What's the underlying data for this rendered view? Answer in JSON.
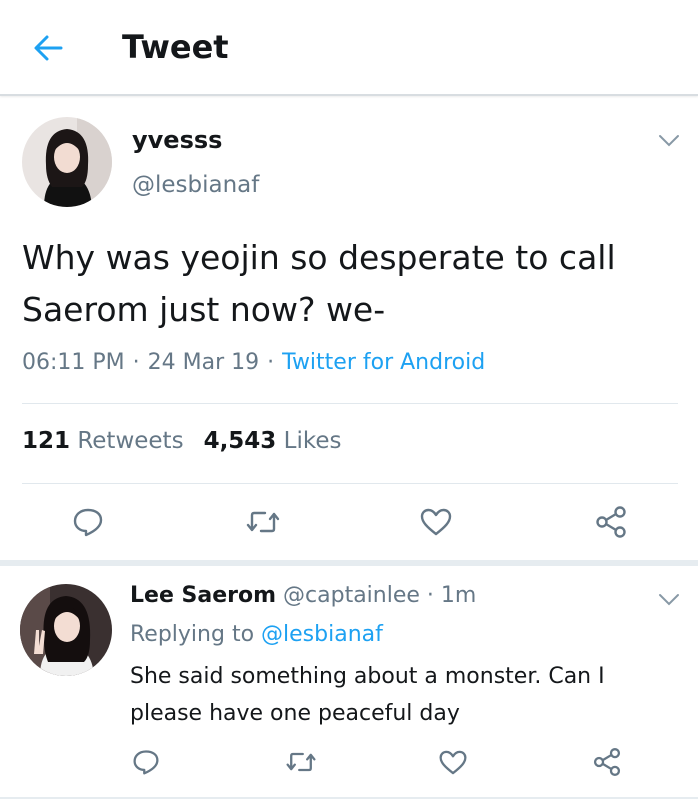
{
  "header": {
    "title": "Tweet",
    "back_icon": "arrow-left-icon",
    "accent": "#1da1f2"
  },
  "tweet": {
    "display_name": "yvesss",
    "handle": "@lesbianaf",
    "text": "Why was yeojin so desperate to call Saerom just now? we-",
    "time": "06:11 PM",
    "date": "24 Mar 19",
    "source": "Twitter for Android",
    "retweet_count": "121",
    "retweet_label": "Retweets",
    "like_count": "4,543",
    "like_label": "Likes",
    "actions": [
      "reply-icon",
      "retweet-icon",
      "like-icon",
      "share-icon"
    ]
  },
  "reply": {
    "display_name": "Lee Saerom",
    "handle": "@captainlee",
    "age": "1m",
    "replying_label": "Replying to",
    "replying_to": "@lesbianaf",
    "text": "She said something about a monster. Can I please have one peaceful day",
    "actions": [
      "reply-icon",
      "retweet-icon",
      "like-icon",
      "share-icon"
    ]
  },
  "colors": {
    "text": "#14171a",
    "secondary": "#657786",
    "link": "#1da1f2",
    "divider": "#e1e8ed"
  }
}
